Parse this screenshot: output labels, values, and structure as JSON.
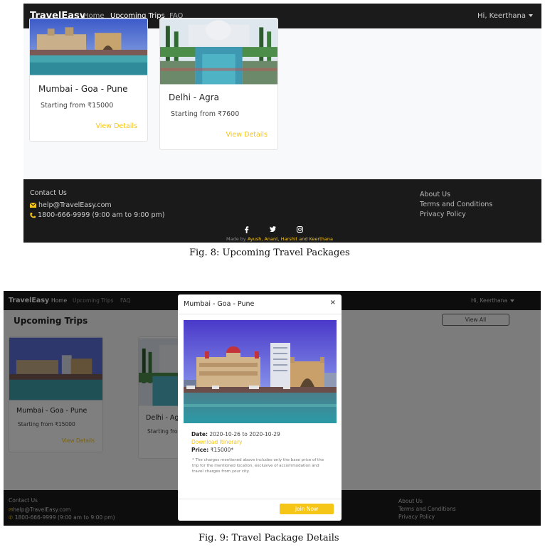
{
  "fig8": {
    "navbar": {
      "brand": "TravelEasy",
      "links": [
        "Home",
        "Upcoming Trips",
        "FAQ"
      ],
      "user": "Hi, Keerthana"
    },
    "cards": [
      {
        "title": "Mumbai - Goa - Pune",
        "price": "Starting from ₹15000",
        "details": "View Details"
      },
      {
        "title": "Delhi - Agra",
        "price": "Starting from ₹7600",
        "details": "View Details"
      }
    ],
    "footer": {
      "contact_title": "Contact Us",
      "email": "help@TravelEasy.com",
      "phone": "1800-666-9999 (9:00 am to 9:00 pm)",
      "links": [
        "About Us",
        "Terms and Conditions",
        "Privacy Policy"
      ],
      "social_icons": [
        "facebook-icon",
        "twitter-icon",
        "instagram-icon"
      ],
      "made_by_prefix": "Made by",
      "made_by_names": "Ayush, Anant, Harshit and Keerthana"
    },
    "caption": "Fig. 8: Upcoming Travel Packages"
  },
  "fig9": {
    "navbar": {
      "brand": "TravelEasy",
      "links": [
        "Home",
        "Upcoming Trips",
        "FAQ"
      ],
      "user": "Hi, Keerthana"
    },
    "page_title": "Upcoming Trips",
    "view_all": "View All",
    "cards": [
      {
        "title": "Mumbai - Goa - Pune",
        "price": "Starting from ₹15000",
        "details": "View Details"
      },
      {
        "title": "Delhi - Ag",
        "price": "Starting fro"
      }
    ],
    "footer": {
      "contact_title": "Contact Us",
      "email": "help@TravelEasy.com",
      "phone": "1800-666-9999 (9:00 am to 9:00 pm)",
      "links": [
        "About Us",
        "Terms and Conditions",
        "Privacy Policy"
      ]
    },
    "modal": {
      "title": "Mumbai - Goa - Pune",
      "close": "×",
      "date_label": "Date:",
      "date_value": "2020-10-26 to 2020-10-29",
      "download": "Download Itinerary",
      "price_label": "Price:",
      "price_value": "₹15000*",
      "note": "* The charges mentioned above includes only the base price of the trip for the mentioned location, exclusive of accommodation and travel charges from your city.",
      "join": "Join Now"
    },
    "caption": "Fig. 9: Travel Package Details"
  },
  "colors": {
    "navbar": "#1b1b1b",
    "accent": "#f5c518",
    "footer": "#1a1a1a"
  }
}
